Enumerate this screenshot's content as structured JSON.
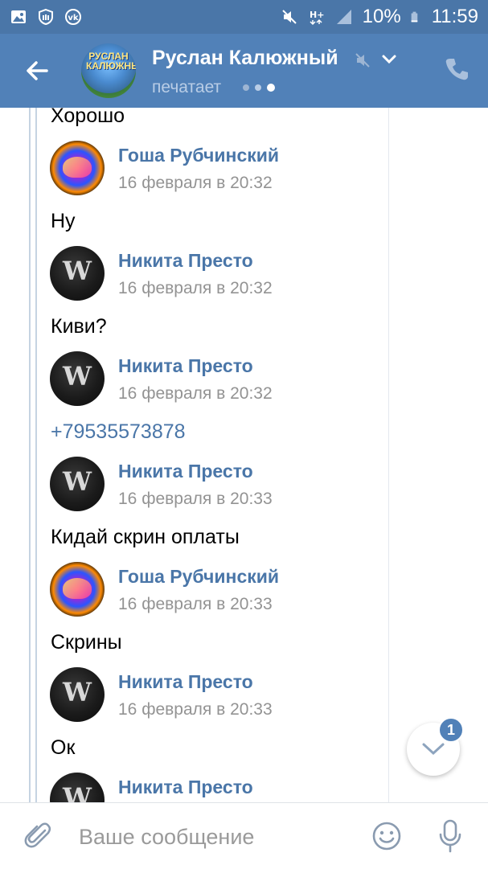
{
  "status_bar": {
    "battery": "10%",
    "time": "11:59",
    "icons": [
      "gallery-icon",
      "shield-icon",
      "vk-icon",
      "mute-icon",
      "h-plus-icon",
      "signal-icon",
      "battery-icon"
    ]
  },
  "header": {
    "title": "Руслан Калюжный",
    "subtitle": "печатает",
    "avatar_text": "РУСЛАН КАЛЮЖНЫЙ",
    "icons": [
      "back-arrow-icon",
      "mute-icon",
      "chevron-down-icon",
      "phone-icon"
    ],
    "accent_color": "#5181b8"
  },
  "messages": [
    {
      "text": "Хорошо"
    },
    {
      "author": "Гоша Рубчинский",
      "avatar": "gosha",
      "date": "16 февраля в 20:32",
      "text": "Ну"
    },
    {
      "author": "Никита Престо",
      "avatar": "nikita",
      "date": "16 февраля в 20:32",
      "text": "Киви?"
    },
    {
      "author": "Никита Престо",
      "avatar": "nikita",
      "date": "16 февраля в 20:32",
      "text": "+79535573878",
      "is_link": true
    },
    {
      "author": "Никита Престо",
      "avatar": "nikita",
      "date": "16 февраля в 20:33",
      "text": "Кидай скрин оплаты"
    },
    {
      "author": "Гоша Рубчинский",
      "avatar": "gosha",
      "date": "16 февраля в 20:33",
      "text": "Скрины"
    },
    {
      "author": "Никита Престо",
      "avatar": "nikita",
      "date": "16 февраля в 20:33",
      "text": "Ок"
    },
    {
      "author": "Никита Престо",
      "avatar": "nikita"
    }
  ],
  "scroll_badge": "1",
  "composer": {
    "placeholder": "Ваше сообщение",
    "value": "",
    "icons": [
      "paperclip-icon",
      "emoji-icon",
      "microphone-icon"
    ]
  }
}
